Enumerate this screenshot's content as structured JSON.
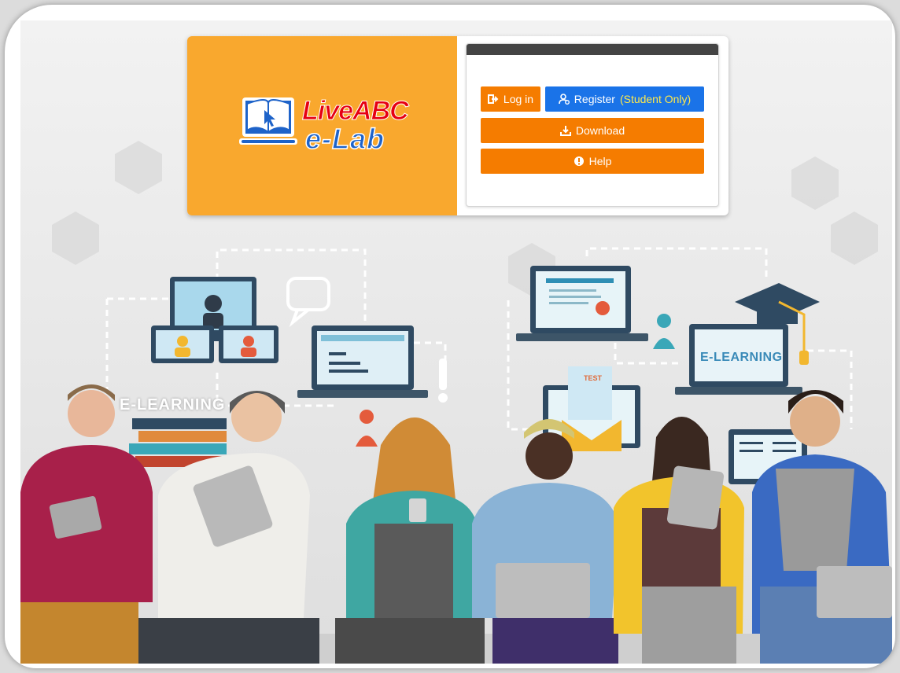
{
  "brand": {
    "logo_line1_live": "Live",
    "logo_line1_abc": "ABC",
    "logo_line2": "e-Lab"
  },
  "auth_panel": {
    "login_label": "Log in",
    "register_label": "Register",
    "register_note": "(Student Only)",
    "download_label": "Download",
    "help_label": "Help"
  },
  "illustration": {
    "elearning_label_left": "E-LEARNING",
    "elearning_label_right": "E-LEARNING",
    "test_label": "TEST"
  },
  "colors": {
    "logo_bg": "#f9a82e",
    "orange_button": "#f57c00",
    "blue_button": "#1a73e8",
    "highlight_text": "#ffe94a",
    "panel_header": "#444444"
  },
  "icons": {
    "login": "sign-in-icon",
    "register": "user-gear-icon",
    "download": "download-icon",
    "help": "info-circle-icon"
  }
}
